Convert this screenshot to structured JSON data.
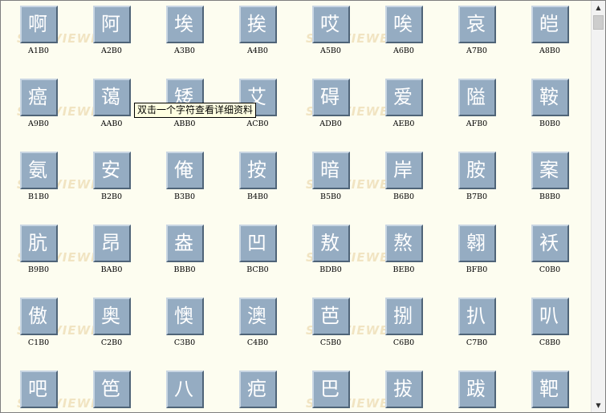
{
  "tooltip": "双击一个字符查看详细资料",
  "watermark_text": "SHX VIEWER",
  "scrollbar": {
    "up_icon": "▲",
    "down_icon": "▼"
  },
  "colors": {
    "tile": "#95acc2",
    "background": "#fdfdf0",
    "watermark": "#f1e4c2"
  },
  "rows": [
    [
      {
        "char": "啊",
        "code": "A1B0"
      },
      {
        "char": "阿",
        "code": "A2B0"
      },
      {
        "char": "埃",
        "code": "A3B0"
      },
      {
        "char": "挨",
        "code": "A4B0"
      },
      {
        "char": "哎",
        "code": "A5B0"
      },
      {
        "char": "唉",
        "code": "A6B0"
      },
      {
        "char": "哀",
        "code": "A7B0"
      },
      {
        "char": "皑",
        "code": "A8B0"
      }
    ],
    [
      {
        "char": "癌",
        "code": "A9B0"
      },
      {
        "char": "蔼",
        "code": "AAB0"
      },
      {
        "char": "矮",
        "code": "ABB0"
      },
      {
        "char": "艾",
        "code": "ACB0"
      },
      {
        "char": "碍",
        "code": "ADB0"
      },
      {
        "char": "爱",
        "code": "AEB0"
      },
      {
        "char": "隘",
        "code": "AFB0"
      },
      {
        "char": "鞍",
        "code": "B0B0"
      }
    ],
    [
      {
        "char": "氨",
        "code": "B1B0"
      },
      {
        "char": "安",
        "code": "B2B0"
      },
      {
        "char": "俺",
        "code": "B3B0"
      },
      {
        "char": "按",
        "code": "B4B0"
      },
      {
        "char": "暗",
        "code": "B5B0"
      },
      {
        "char": "岸",
        "code": "B6B0"
      },
      {
        "char": "胺",
        "code": "B7B0"
      },
      {
        "char": "案",
        "code": "B8B0"
      }
    ],
    [
      {
        "char": "肮",
        "code": "B9B0"
      },
      {
        "char": "昂",
        "code": "BAB0"
      },
      {
        "char": "盎",
        "code": "BBB0"
      },
      {
        "char": "凹",
        "code": "BCB0"
      },
      {
        "char": "敖",
        "code": "BDB0"
      },
      {
        "char": "熬",
        "code": "BEB0"
      },
      {
        "char": "翱",
        "code": "BFB0"
      },
      {
        "char": "袄",
        "code": "C0B0"
      }
    ],
    [
      {
        "char": "傲",
        "code": "C1B0"
      },
      {
        "char": "奥",
        "code": "C2B0"
      },
      {
        "char": "懊",
        "code": "C3B0"
      },
      {
        "char": "澳",
        "code": "C4B0"
      },
      {
        "char": "芭",
        "code": "C5B0"
      },
      {
        "char": "捌",
        "code": "C6B0"
      },
      {
        "char": "扒",
        "code": "C7B0"
      },
      {
        "char": "叭",
        "code": "C8B0"
      }
    ],
    [
      {
        "char": "吧",
        "code": "C9B0"
      },
      {
        "char": "笆",
        "code": "CAB0"
      },
      {
        "char": "八",
        "code": "CBB0"
      },
      {
        "char": "疤",
        "code": "CCB0"
      },
      {
        "char": "巴",
        "code": "CDB0"
      },
      {
        "char": "拔",
        "code": "CEB0"
      },
      {
        "char": "跋",
        "code": "CFB0"
      },
      {
        "char": "靶",
        "code": "D0B0"
      }
    ]
  ]
}
